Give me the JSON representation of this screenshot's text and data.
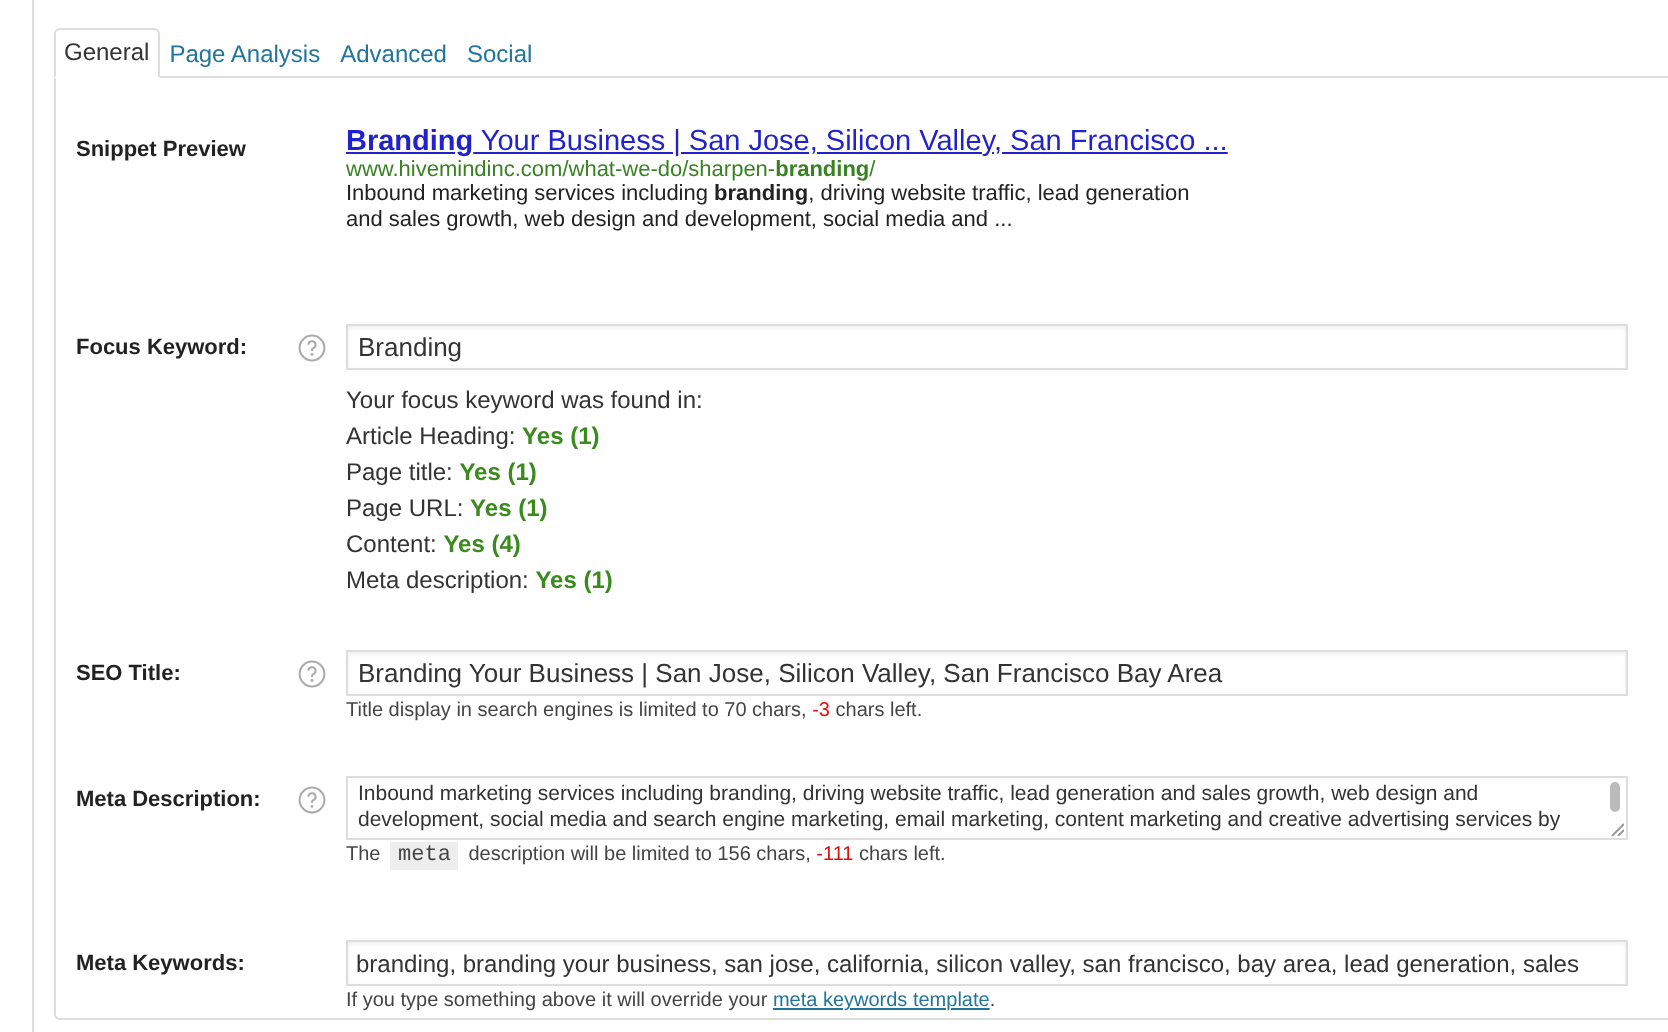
{
  "tabs": [
    {
      "label": "General",
      "selected": true
    },
    {
      "label": "Page Analysis",
      "selected": false
    },
    {
      "label": "Advanced",
      "selected": false
    },
    {
      "label": "Social",
      "selected": false
    }
  ],
  "snippet": {
    "label": "Snippet Preview",
    "title": "**Branding** Your Business | San Jose, Silicon Valley, San Francisco ...",
    "url": "www.hivemindinc.com/what-we-do/sharpen-**branding**/",
    "description": [
      "Inbound marketing services including **branding**, driving website traffic, lead generation",
      "and sales growth, web design and development, social media and ..."
    ]
  },
  "focus_keyword": {
    "label": "Focus Keyword:",
    "value": "Branding",
    "intro": "Your focus keyword was found in:",
    "results": [
      {
        "label": "Article Heading:",
        "value": "Yes (1)"
      },
      {
        "label": "Page title:",
        "value": "Yes (1)"
      },
      {
        "label": "Page URL:",
        "value": "Yes (1)"
      },
      {
        "label": "Content:",
        "value": "Yes (4)"
      },
      {
        "label": "Meta description:",
        "value": "Yes (1)"
      }
    ]
  },
  "seo_title": {
    "label": "SEO Title:",
    "value": "Branding Your Business | San Jose, Silicon Valley, San Francisco Bay Area",
    "hint": [
      {
        "kind": "text",
        "text": "Title display in search engines is limited to 70 chars, "
      },
      {
        "kind": "count",
        "text": "-3"
      },
      {
        "kind": "text",
        "text": " chars left."
      }
    ]
  },
  "meta_description": {
    "label": "Meta Description:",
    "lines": [
      "Inbound marketing services including branding, driving website traffic, lead generation and sales growth, web design and",
      "development, social media and search engine marketing, email marketing, content marketing and creative advertising services by"
    ],
    "hint": [
      {
        "kind": "text",
        "text": "The "
      },
      {
        "kind": "code",
        "text": "meta"
      },
      {
        "kind": "text",
        "text": " description will be limited to 156 chars, "
      },
      {
        "kind": "count",
        "text": "-111"
      },
      {
        "kind": "text",
        "text": " chars left."
      }
    ]
  },
  "meta_keywords": {
    "label": "Meta Keywords:",
    "value": "branding, branding your business, san jose, california, silicon valley, san francisco, bay area, lead generation, sales",
    "hint": [
      {
        "kind": "text",
        "text": "If you type something above it will override your "
      },
      {
        "kind": "link",
        "text": "meta keywords template"
      },
      {
        "kind": "text",
        "text": "."
      }
    ]
  }
}
